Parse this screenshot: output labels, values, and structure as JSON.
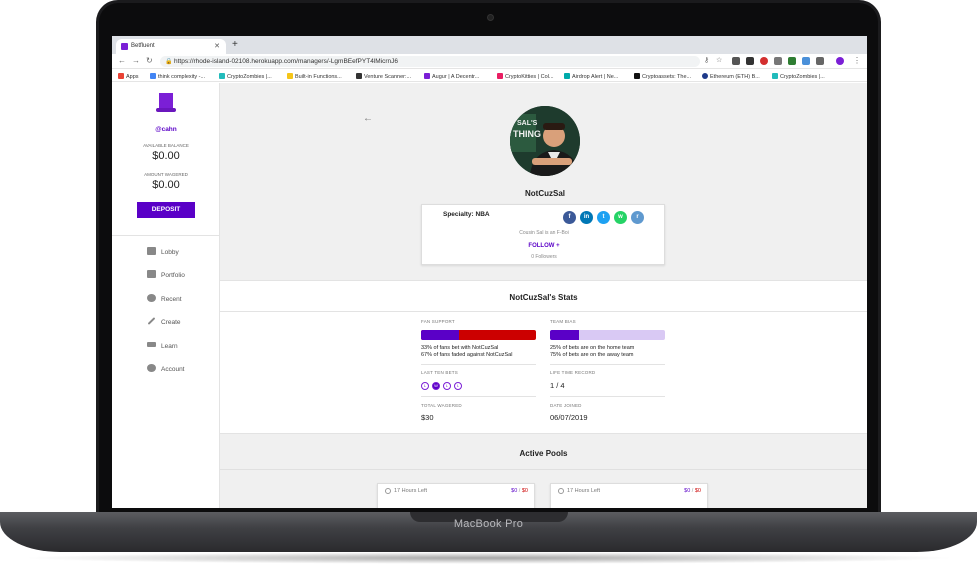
{
  "browser": {
    "tab_title": "Betfluent",
    "url": "https://rhode-island-02108.herokuapp.com/managers/-LgmBEefPYT4lMicrnJ6",
    "bookmarks": [
      "Apps",
      "think complexity -...",
      "CryptoZombies |...",
      "Built-in Functions...",
      "Venture Scanner:...",
      "Augur | A Decentr...",
      "CryptoKitties | Col...",
      "Airdrop Alert | Ne...",
      "Cryptoassets: The...",
      "Ethereum (ETH) B...",
      "CryptoZombies |..."
    ]
  },
  "sidebar": {
    "username": "@cahn",
    "available_label": "AVAILABLE BALANCE",
    "available_value": "$0.00",
    "wagered_label": "AMOUNT WAGERED",
    "wagered_value": "$0.00",
    "deposit_label": "DEPOSIT",
    "nav": [
      {
        "label": "Lobby",
        "icon": "lobby-icon"
      },
      {
        "label": "Portfolio",
        "icon": "portfolio-icon"
      },
      {
        "label": "Recent",
        "icon": "history-icon"
      },
      {
        "label": "Create",
        "icon": "pencil-icon"
      },
      {
        "label": "Learn",
        "icon": "graduation-cap-icon"
      },
      {
        "label": "Account",
        "icon": "account-icon"
      }
    ]
  },
  "profile": {
    "name": "NotCuzSal",
    "specialty": "Specialty: NBA",
    "bio": "Cousin Sal is an F-Boi",
    "follow_label": "FOLLOW +",
    "followers": "0 Followers",
    "avatar_text": [
      "SAL'S",
      "THING"
    ]
  },
  "stats": {
    "title": "NotCuzSal's Stats",
    "fan_support_label": "FAN SUPPORT",
    "fan_support_fraction": 0.33,
    "fan_support_lines": [
      "33% of fans bet with NotCuzSal",
      "67% of fans faded against NotCuzSal"
    ],
    "team_bias_label": "TEAM BIAS",
    "team_bias_fraction": 0.25,
    "team_bias_lines": [
      "25% of bets are on the home team",
      "75% of bets are on the away team"
    ],
    "last_ten_label": "LAST TEN BETS",
    "last_ten": [
      "L",
      "W",
      "L",
      "L"
    ],
    "lifetime_label": "LIFE TIME RECORD",
    "lifetime_value": "1 / 4",
    "total_wagered_label": "TOTAL WAGERED",
    "total_wagered_value": "$30",
    "date_joined_label": "DATE JOINED",
    "date_joined_value": "06/07/2019"
  },
  "pools": {
    "title": "Active Pools",
    "items": [
      {
        "time": "17 Hours Left",
        "amount_a": "$0",
        "amount_b": "$0"
      },
      {
        "time": "17 Hours Left",
        "amount_a": "$0",
        "amount_b": "$0"
      }
    ]
  },
  "device_label": "MacBook Pro",
  "colors": {
    "accent": "#5a00c7",
    "red": "#cc0000",
    "light_purple": "#d9c9f4"
  }
}
